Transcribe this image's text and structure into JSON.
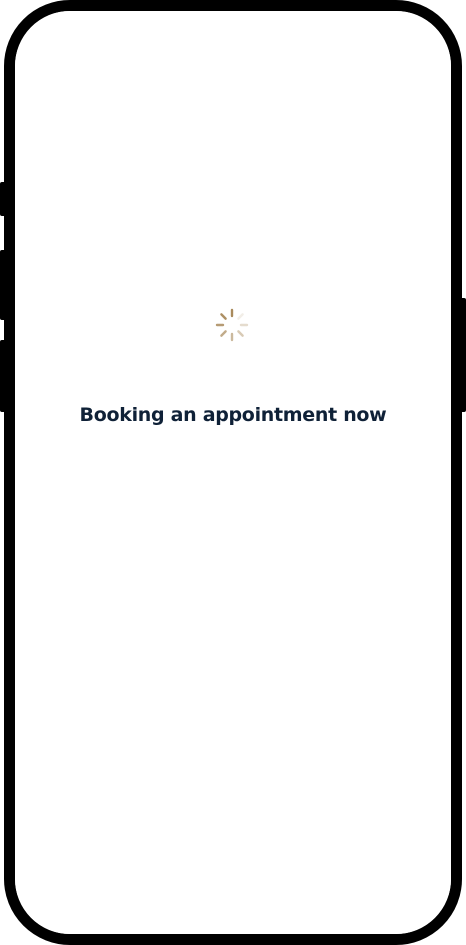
{
  "loading": {
    "message": "Booking an appointment now",
    "spinner_icon": "loading-spinner-icon"
  },
  "colors": {
    "spinner": "#a98a5c",
    "text": "#0f2137",
    "frame": "#000000",
    "screen": "#ffffff"
  }
}
